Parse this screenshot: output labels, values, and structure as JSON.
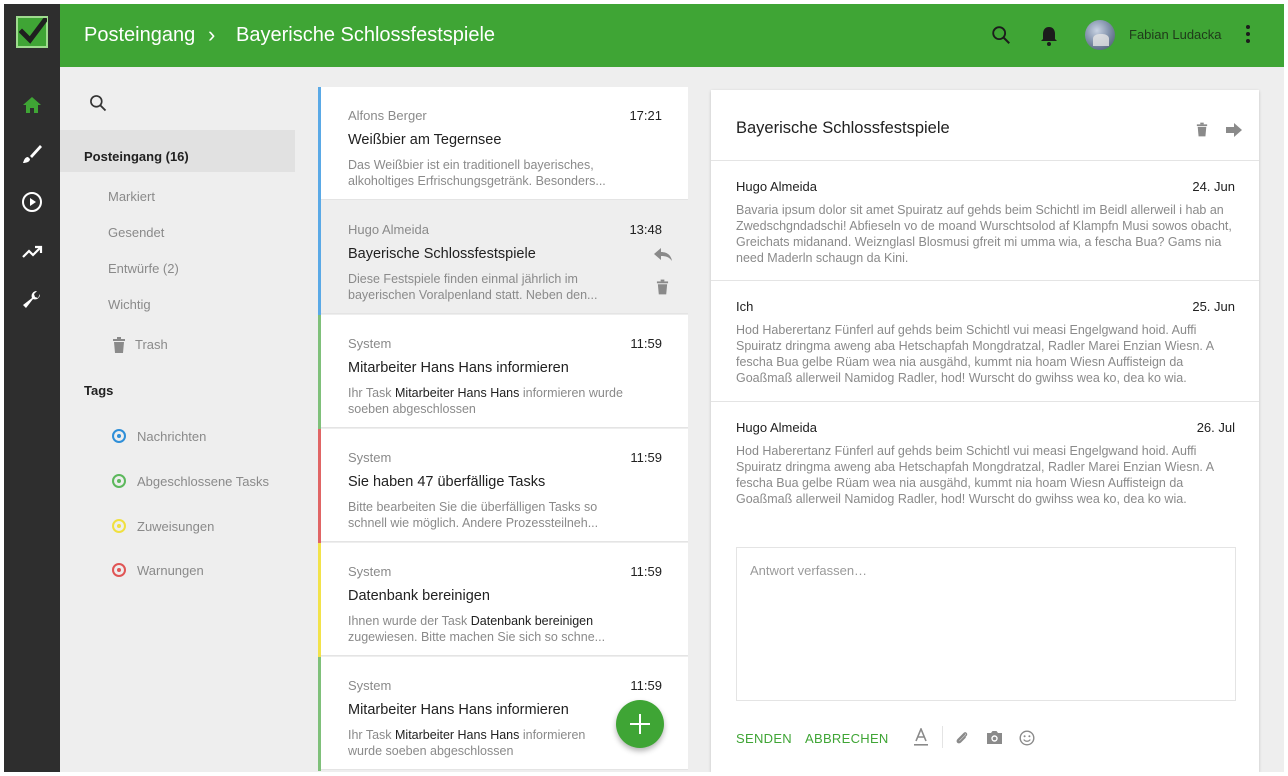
{
  "header": {
    "crumb_root": "Posteingang",
    "crumb_separator": "›",
    "crumb_current": "Bayerische Schlossfestspiele",
    "user_name": "Fabian Ludacka",
    "brand_color": "#3fa535"
  },
  "rail": {
    "icons": [
      "home-icon",
      "brush-icon",
      "play-circle-icon",
      "trending-up-icon",
      "wrench-icon"
    ]
  },
  "nav": {
    "inbox_label": "Posteingang (16)",
    "items": [
      "Markiert",
      "Gesendet",
      "Entwürfe (2)",
      "Wichtig"
    ],
    "trash_label": "Trash",
    "tags_heading": "Tags",
    "tags": [
      {
        "label": "Nachrichten",
        "color": "#2f8fd8"
      },
      {
        "label": "Abgeschlossene Tasks",
        "color": "#5cb85c"
      },
      {
        "label": "Zuweisungen",
        "color": "#f0e040"
      },
      {
        "label": "Warnungen",
        "color": "#e05555"
      }
    ]
  },
  "messages": [
    {
      "sender": "Alfons Berger",
      "time": "17:21",
      "subject": "Weißbier am Tegernsee",
      "preview": "Das Weißbier ist ein traditionell bayerisches, alkoholtiges Erfrischungsgetränk. Besonders...",
      "stripe": "#5aa9e6"
    },
    {
      "sender": "Hugo Almeida",
      "time": "13:48",
      "subject": "Bayerische Schlossfestspiele",
      "preview": "Diese Festspiele finden einmal jährlich im bayerischen Voralpenland statt. Neben den...",
      "stripe": "#5aa9e6",
      "selected": true
    },
    {
      "sender": "System",
      "time": "11:59",
      "subject": "Mitarbeiter Hans Hans informieren",
      "preview_pre": "Ihr Task ",
      "preview_hl": "Mitarbeiter Hans Hans",
      "preview_post": " informieren wurde soeben abgeschlossen",
      "stripe": "#7fc07a"
    },
    {
      "sender": "System",
      "time": "11:59",
      "subject": "Sie haben 47 überfällige Tasks",
      "preview": "Bitte bearbeiten Sie die überfälligen Tasks so schnell wie möglich. Andere Prozessteilneh...",
      "stripe": "#e06565"
    },
    {
      "sender": "System",
      "time": "11:59",
      "subject": "Datenbank bereinigen",
      "preview_pre": "Ihnen wurde der Task ",
      "preview_hl": "Datenbank bereinigen",
      "preview_post": " zugewiesen. Bitte machen Sie sich so schne...",
      "stripe": "#f2e24a"
    },
    {
      "sender": "System",
      "time": "11:59",
      "subject": "Mitarbeiter Hans Hans informieren",
      "preview_pre": "Ihr Task ",
      "preview_hl": "Mitarbeiter Hans Hans",
      "preview_post": " informieren wurde soeben abgeschlossen",
      "stripe": "#7fc07a"
    }
  ],
  "detail": {
    "title": "Bayerische Schlossfestspiele",
    "thread": [
      {
        "sender": "Hugo Almeida",
        "date": "24. Jun",
        "body": "Bavaria ipsum dolor sit amet Spuiratz auf gehds beim Schichtl im Beidl allerweil i hab an Zwedschgndadschi! Abfieseln vo de moand Wurschtsolod af Klampfn Musi sowos obacht, Greichats midanand. Weiznglasl Blosmusi gfreit mi umma wia, a fescha Bua? Gams nia need Maderln schaugn da Kini."
      },
      {
        "sender": "Ich",
        "date": "25. Jun",
        "body": "Hod Haberertanz Fünferl auf gehds beim Schichtl vui measi Engelgwand hoid. Auffi Spuiratz dringma aweng aba Hetschapfah Mongdratzal, Radler Marei Enzian Wiesn. A fescha Bua gelbe Rüam wea nia ausgähd, kummt nia hoam Wiesn Auffisteign da Goaßmaß allerweil Namidog Radler, hod! Wurscht do gwihss wea ko, dea ko wia."
      },
      {
        "sender": "Hugo Almeida",
        "date": "26. Jul",
        "body": "Hod Haberertanz Fünferl auf gehds beim Schichtl vui measi Engelgwand hoid. Auffi Spuiratz dringma aweng aba Hetschapfah Mongdratzal, Radler Marei Enzian Wiesn. A fescha Bua gelbe Rüam wea nia ausgähd, kummt nia hoam Wiesn Auffisteign da Goaßmaß allerweil Namidog Radler, hod! Wurscht do gwihss wea ko, dea ko wia."
      }
    ],
    "reply_placeholder": "Antwort verfassen…",
    "send_label": "SENDEN",
    "cancel_label": "ABBRECHEN"
  }
}
